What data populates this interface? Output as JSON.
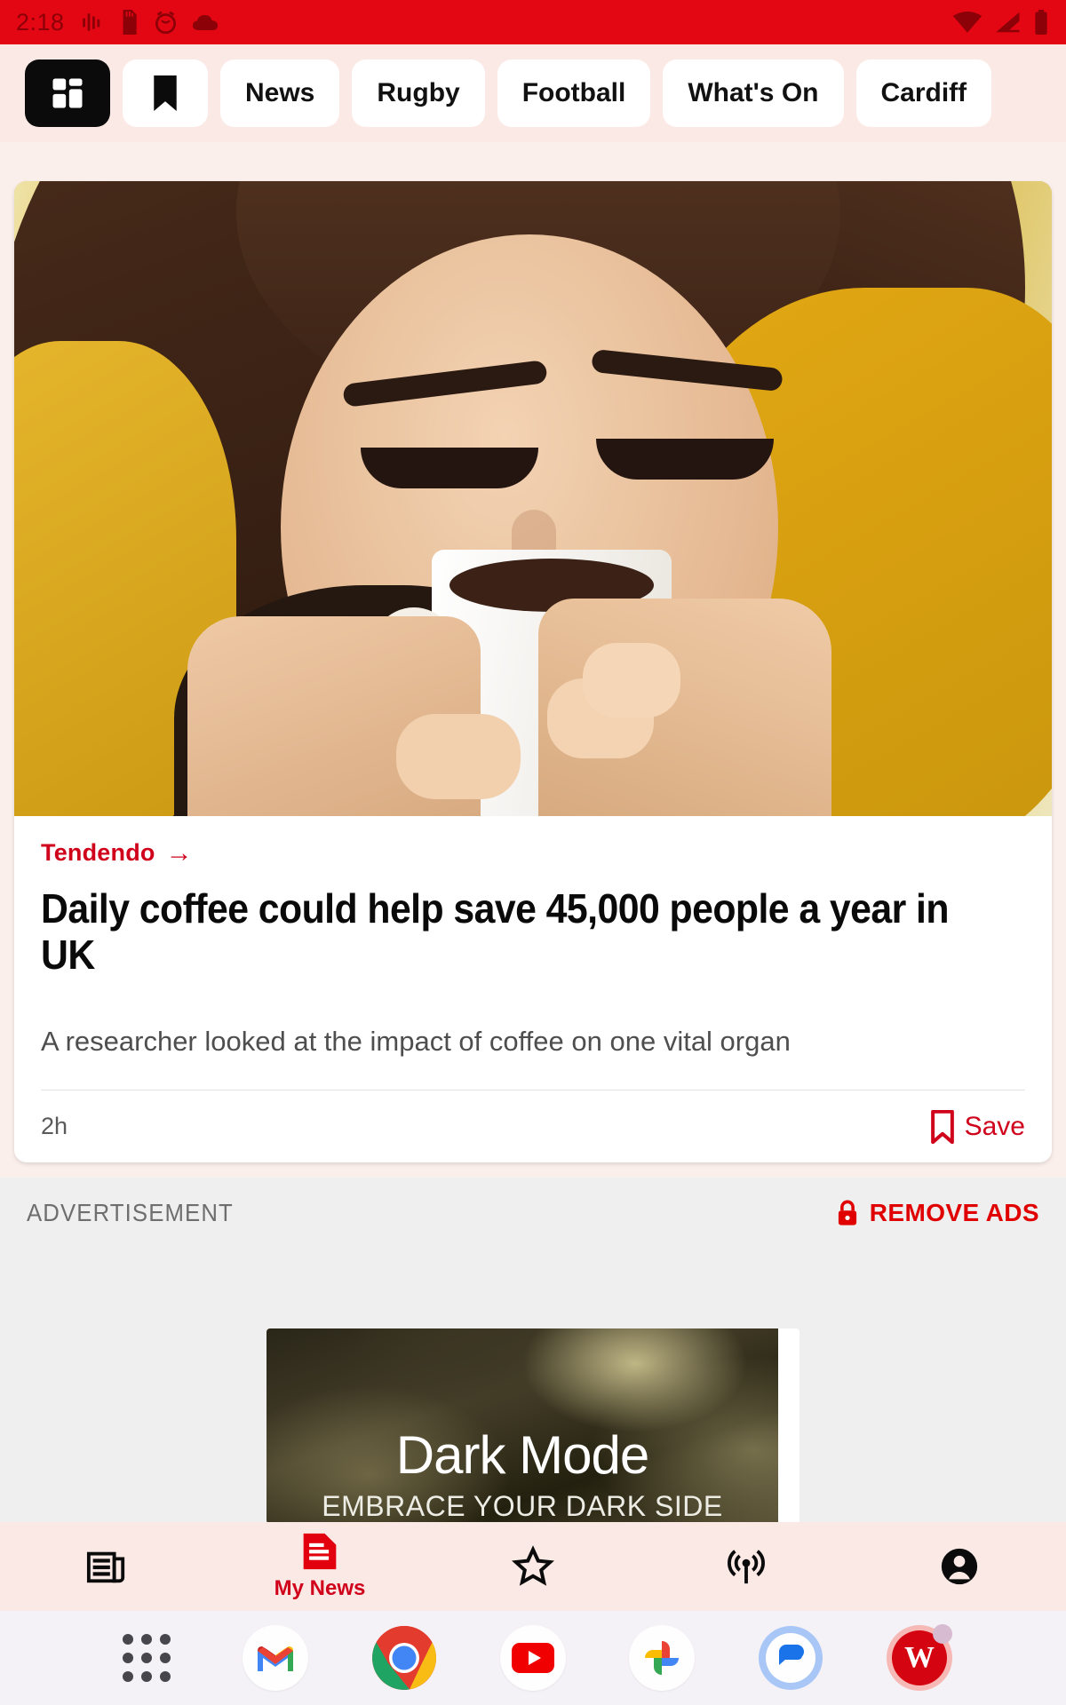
{
  "status_bar": {
    "time": "2:18",
    "left_icons": [
      "signal-bars-icon",
      "sd-card-icon",
      "alarm-icon",
      "cloud-icon"
    ],
    "right_icons": [
      "wifi-icon",
      "cellular-signal-icon",
      "battery-icon"
    ],
    "background_color": "#E30613",
    "icon_color": "#8C0008"
  },
  "tab_bar": {
    "background_color": "#FBE9E6",
    "tabs": [
      {
        "id": "dashboard",
        "label": "",
        "icon": "dashboard-grid-icon",
        "active": true
      },
      {
        "id": "bookmarks",
        "label": "",
        "icon": "bookmark-icon",
        "active": false
      },
      {
        "id": "news",
        "label": "News",
        "icon": "",
        "active": false
      },
      {
        "id": "rugby",
        "label": "Rugby",
        "icon": "",
        "active": false
      },
      {
        "id": "football",
        "label": "Football",
        "icon": "",
        "active": false
      },
      {
        "id": "whats-on",
        "label": "What's On",
        "icon": "",
        "active": false
      },
      {
        "id": "cardiff",
        "label": "Cardiff",
        "icon": "",
        "active": false
      }
    ]
  },
  "article_card": {
    "image_alt": "woman in yellow jumper drinking coffee from a white mug",
    "kicker": "Tendendo",
    "kicker_arrow": "→",
    "headline": "Daily coffee could help save 45,000 people a year in UK",
    "standfirst": "A researcher looked at the impact of coffee on one vital organ",
    "timestamp": "2h",
    "save_label": "Save",
    "save_icon": "bookmark-outline-icon",
    "accent_color": "#D0021B"
  },
  "advertisement": {
    "label": "ADVERTISEMENT",
    "remove_ads_label": "REMOVE ADS",
    "remove_ads_icon": "lock-icon",
    "creative": {
      "title": "Dark Mode",
      "subtitle": "EMBRACE YOUR DARK SIDE"
    }
  },
  "bottom_nav": {
    "background_color": "#FBE9E6",
    "items": [
      {
        "id": "news-feed",
        "icon": "newspaper-icon",
        "label": "",
        "active": false
      },
      {
        "id": "my-news",
        "icon": "document-icon",
        "label": "My News",
        "active": true
      },
      {
        "id": "favourites",
        "icon": "star-outline-icon",
        "label": "",
        "active": false
      },
      {
        "id": "radio",
        "icon": "broadcast-icon",
        "label": "",
        "active": false
      },
      {
        "id": "account",
        "icon": "account-circle-icon",
        "label": "",
        "active": false
      }
    ]
  },
  "dock": {
    "background_color": "#F4F1F7",
    "apps": [
      {
        "id": "all-apps",
        "icon": "apps-grid-icon",
        "label": ""
      },
      {
        "id": "gmail",
        "icon": "gmail-icon",
        "label": ""
      },
      {
        "id": "chrome",
        "icon": "chrome-icon",
        "label": ""
      },
      {
        "id": "youtube",
        "icon": "youtube-icon",
        "label": ""
      },
      {
        "id": "photos",
        "icon": "google-photos-icon",
        "label": ""
      },
      {
        "id": "messages",
        "icon": "messages-icon",
        "label": ""
      },
      {
        "id": "walesonline",
        "icon": "walesonline-icon",
        "label": "W"
      }
    ]
  }
}
